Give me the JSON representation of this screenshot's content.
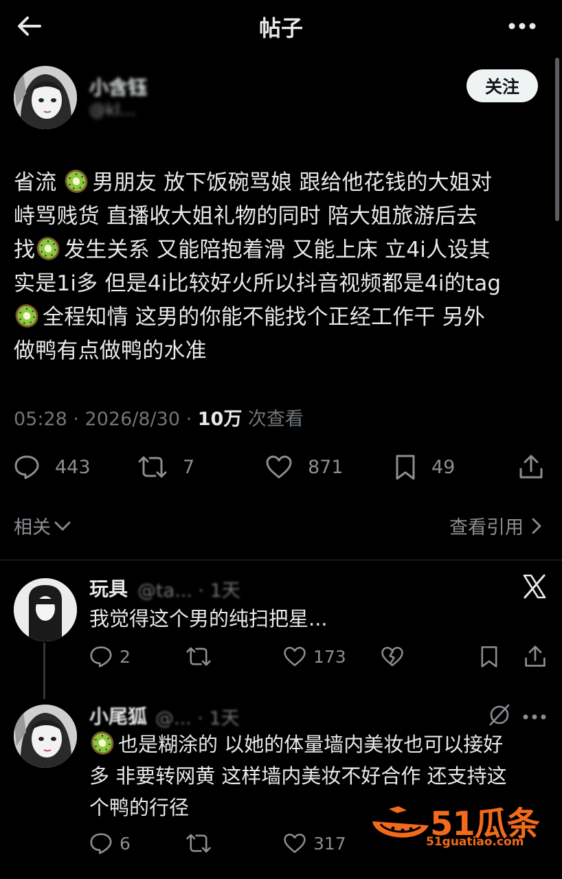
{
  "header": {
    "title": "帖子"
  },
  "post": {
    "author_name": "小含钰",
    "author_handle": "@kl...",
    "follow_label": "关注",
    "body_lines": [
      [
        "省流 ",
        "kiwi",
        "男朋友 放下饭碗骂娘 跟给他花钱的大姐对"
      ],
      [
        "峙骂贱货 直播收大姐礼物的同时 陪大姐旅游后去"
      ],
      [
        "找",
        "kiwi",
        "发生关系 又能陪抱着滑 又能上床 立4i人设其"
      ],
      [
        "实是1i多 但是4i比较好火所以抖音视频都是4i的tag"
      ],
      [
        "kiwi",
        "全程知情 这男的你能不能找个正经工作干 另外"
      ],
      [
        "做鸭有点做鸭的水准"
      ]
    ],
    "time": "05:28 · 2026/8/30 · ",
    "views": "10万",
    "views_suffix": " 次查看",
    "stats": {
      "replies": "443",
      "reposts": "7",
      "likes": "871",
      "bookmarks": "49"
    },
    "related_label": "相关",
    "quotes_label": "查看引用"
  },
  "replies": [
    {
      "name": "玩具",
      "handle": "@ta... · 1天",
      "text_lines": [
        "我觉得这个男的纯扫把星..."
      ],
      "stats": {
        "replies": "2",
        "likes": "173"
      }
    },
    {
      "name": "小尾狐",
      "handle": "@... · 1天",
      "text_lines": [
        [
          "kiwi",
          "也是糊涂的 以她的体量墙内美妆也可以接好"
        ],
        [
          "多 非要转网黄 这样墙内美妆不好合作 还支持这"
        ],
        [
          "个鸭的行径"
        ]
      ],
      "stats": {
        "replies": "6",
        "likes": "317"
      }
    }
  ],
  "watermark": {
    "brand": "51瓜条",
    "url": "51guatiao.com"
  },
  "colors": {
    "background": "#000000",
    "text": "#e7e9ea",
    "muted": "#71767b",
    "brand": "#f26a1b"
  }
}
